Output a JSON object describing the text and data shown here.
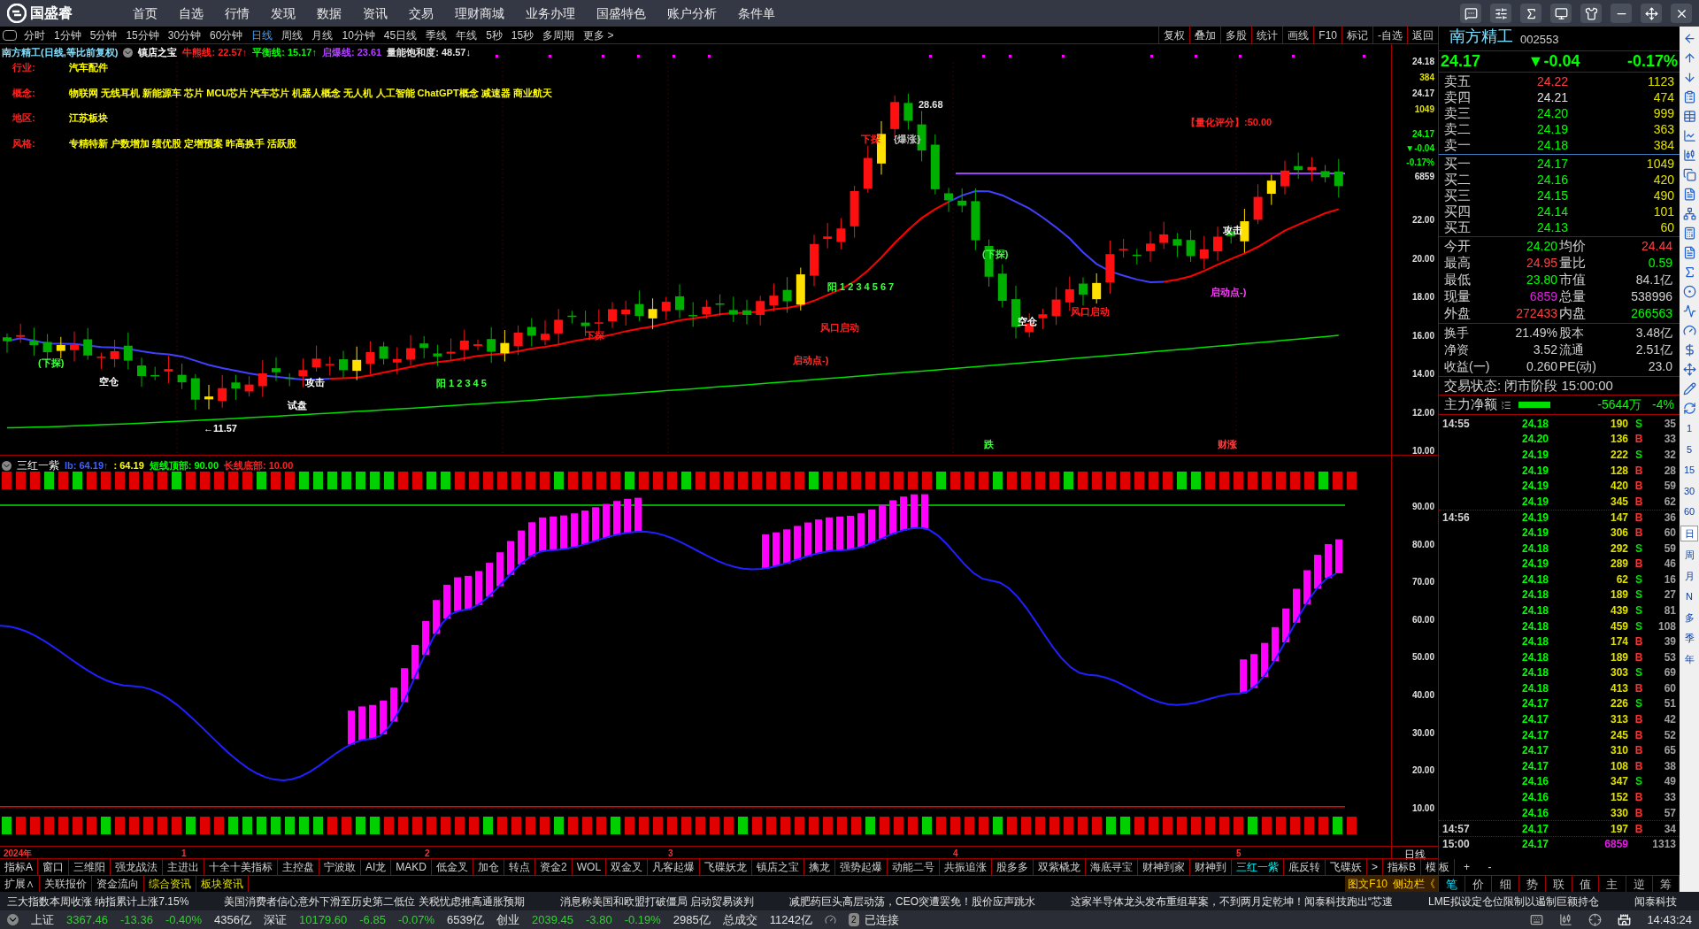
{
  "app": {
    "logo_text": "国盛睿",
    "menu": [
      "首页",
      "自选",
      "行情",
      "发现",
      "数据",
      "资讯",
      "交易",
      "理财商城",
      "业务办理",
      "国盛特色",
      "账户分析",
      "条件单"
    ]
  },
  "periods": [
    {
      "label": "分时",
      "selected": false
    },
    {
      "label": "1分钟",
      "selected": false
    },
    {
      "label": "5分钟",
      "selected": false
    },
    {
      "label": "15分钟",
      "selected": false
    },
    {
      "label": "30分钟",
      "selected": false
    },
    {
      "label": "60分钟",
      "selected": false
    },
    {
      "label": "日线",
      "selected": true
    },
    {
      "label": "周线",
      "selected": false
    },
    {
      "label": "月线",
      "selected": false
    },
    {
      "label": "10分钟",
      "selected": false
    },
    {
      "label": "45日线",
      "selected": false
    },
    {
      "label": "季线",
      "selected": false
    },
    {
      "label": "年线",
      "selected": false
    },
    {
      "label": "5秒",
      "selected": false
    },
    {
      "label": "15秒",
      "selected": false
    },
    {
      "label": "多周期",
      "selected": false
    },
    {
      "label": "更多 >",
      "selected": false
    }
  ],
  "chart_tools": [
    "复权",
    "叠加",
    "多股",
    "统计",
    "画线",
    "F10",
    "标记",
    "-自选",
    "返回"
  ],
  "chart_header": {
    "title": "南方精工(日线,等比前复权)",
    "indicator": "镇店之宝",
    "lines": [
      {
        "label": "牛熊线:",
        "value": "22.57↑",
        "color": "#ff2020"
      },
      {
        "label": "平衡线:",
        "value": "15.17↑",
        "color": "#00ff00"
      },
      {
        "label": "启爆线:",
        "value": "23.61",
        "color": "#b040ff"
      },
      {
        "label": "量能饱和度:",
        "value": "48.57↓",
        "color": "#e0e0e0"
      }
    ]
  },
  "stock_info": [
    {
      "label": "行业:",
      "value": "汽车配件"
    },
    {
      "label": "概念:",
      "value": "物联网 无线耳机 新能源车 芯片 MCU芯片 汽车芯片 机器人概念 无人机 人工智能 ChatGPT概念 减速器 商业航天"
    },
    {
      "label": "地区:",
      "value": "江苏板块"
    },
    {
      "label": "风格:",
      "value": "专精特新 户数增加 绩优股 定增预案 昨高换手 活跃股"
    }
  ],
  "chart_labels": [
    {
      "text": "28.68",
      "color": "#e0e0e0"
    },
    {
      "text": "【量化评分】:50.00",
      "color": "#ff2020"
    },
    {
      "text": "下探",
      "color": "#ff2020"
    },
    {
      "text": "{爆涨}",
      "color": "#c0c0c0"
    },
    {
      "text": "攻击",
      "color": "#ffffff"
    },
    {
      "text": "(下探)",
      "color": "#40ff40"
    },
    {
      "text": "阳 1 2 3 4 5 6 7",
      "color": "#40ff40"
    },
    {
      "text": "启动点-)",
      "color": "#ff40ff"
    },
    {
      "text": "风口启动",
      "color": "#ff2020"
    },
    {
      "text": "空仓",
      "color": "#ffffff"
    },
    {
      "text": "风口启动",
      "color": "#ff2020"
    },
    {
      "text": "下探",
      "color": "#ff2020"
    },
    {
      "text": "启动点-)",
      "color": "#ff3030"
    },
    {
      "text": "(下探)",
      "color": "#40ff40"
    },
    {
      "text": "空仓",
      "color": "#ffffff"
    },
    {
      "text": "攻击",
      "color": "#ffffff"
    },
    {
      "text": "阳 1 2 3 4 5",
      "color": "#40ff40"
    },
    {
      "text": "试盘",
      "color": "#ffffff"
    },
    {
      "text": "←11.57",
      "color": "#ffffff"
    },
    {
      "text": "跌",
      "color": "#40ff40"
    },
    {
      "text": "财涨",
      "color": "#ff4040"
    }
  ],
  "price_axis": {
    "quote": [
      {
        "text": "24.18",
        "color": "#e0e0e0"
      },
      {
        "text": "384",
        "color": "#e0e000"
      },
      {
        "text": "24.17",
        "color": "#e0e0e0"
      },
      {
        "text": "1049",
        "color": "#e0e000"
      },
      {
        "text": "24.17",
        "color": "#00ff00"
      },
      {
        "text": "▼-0.04",
        "color": "#00ff00"
      },
      {
        "text": "-0.17%",
        "color": "#00ff00"
      },
      {
        "text": "6859",
        "color": "#e0e0e0"
      }
    ],
    "ticks": [
      "22.00",
      "20.00",
      "18.00",
      "16.00",
      "14.00",
      "12.00",
      "10.00"
    ]
  },
  "indicator_header": {
    "name": "三红一紫",
    "parts": [
      {
        "text": "lb: 64.19↑",
        "color": "#4060ff"
      },
      {
        "text": ": 64.19",
        "color": "#ffff00"
      },
      {
        "text": "短线顶部: 90.00",
        "color": "#00ff00"
      },
      {
        "text": "长线底部: 10.00",
        "color": "#ff2020"
      }
    ]
  },
  "indicator_axis": [
    "90.00",
    "80.00",
    "70.00",
    "60.00",
    "50.00",
    "40.00",
    "30.00",
    "20.00",
    "10.00"
  ],
  "date_axis": [
    "2024年",
    "1",
    "2",
    "3",
    "4",
    "5"
  ],
  "period_label": "日线",
  "indicator_tabs": [
    {
      "label": "指标A",
      "selected": false
    },
    {
      "label": "窗口",
      "selected": false
    },
    {
      "label": "三维阳",
      "selected": false
    },
    {
      "label": "强龙战法",
      "selected": false
    },
    {
      "label": "主进出",
      "selected": false
    },
    {
      "label": "十全十美指标",
      "selected": false
    },
    {
      "label": "主控盘",
      "selected": false
    },
    {
      "label": "宁波敢",
      "selected": false
    },
    {
      "label": "AI龙",
      "selected": false
    },
    {
      "label": "MAKD",
      "selected": false
    },
    {
      "label": "低金叉",
      "selected": false
    },
    {
      "label": "加仓",
      "selected": false
    },
    {
      "label": "转点",
      "selected": false
    },
    {
      "label": "资金2",
      "selected": false
    },
    {
      "label": "WOL",
      "selected": false
    },
    {
      "label": "双金叉",
      "selected": false
    },
    {
      "label": "凡客起爆",
      "selected": false
    },
    {
      "label": "飞碟妖龙",
      "selected": false
    },
    {
      "label": "镇店之宝",
      "selected": false
    },
    {
      "label": "擒龙",
      "selected": false
    },
    {
      "label": "强势起爆",
      "selected": false
    },
    {
      "label": "动能二号",
      "selected": false
    },
    {
      "label": "共振追涨",
      "selected": false
    },
    {
      "label": "股多多",
      "selected": false
    },
    {
      "label": "双紫橇龙",
      "selected": false
    },
    {
      "label": "海底寻宝",
      "selected": false
    },
    {
      "label": "财神到家",
      "selected": false
    },
    {
      "label": "财神到",
      "selected": false
    },
    {
      "label": "三红一紫",
      "selected": true
    },
    {
      "label": "底反转",
      "selected": false
    },
    {
      "label": "飞碟妖",
      "selected": false
    },
    {
      "label": ">",
      "selected": false
    }
  ],
  "indicator_tabs_right": [
    "指标B",
    "模 板"
  ],
  "zoom_buttons": [
    "+",
    "-"
  ],
  "extra_tabs": [
    {
      "label": "扩展∧",
      "highlight": false
    },
    {
      "label": "关联报价",
      "highlight": false
    },
    {
      "label": "资金流向",
      "highlight": false
    },
    {
      "label": "综合资讯",
      "highlight": true
    },
    {
      "label": "板块资讯",
      "highlight": true
    }
  ],
  "side_links": [
    "图文F10",
    "侧边栏《"
  ],
  "quote_panel": {
    "name": "南方精工",
    "code": "002553",
    "price": "24.17",
    "change": "▼-0.04",
    "change_pct": "-0.17%",
    "asks": [
      {
        "label": "卖五",
        "price": "24.22",
        "volume": "1123",
        "color": "#ff4040"
      },
      {
        "label": "卖四",
        "price": "24.21",
        "volume": "474",
        "color": "#e0e0e0"
      },
      {
        "label": "卖三",
        "price": "24.20",
        "volume": "999",
        "color": "#00ff00"
      },
      {
        "label": "卖二",
        "price": "24.19",
        "volume": "363",
        "color": "#00ff00"
      },
      {
        "label": "卖一",
        "price": "24.18",
        "volume": "384",
        "color": "#00ff00"
      }
    ],
    "bids": [
      {
        "label": "买一",
        "price": "24.17",
        "volume": "1049",
        "color": "#00ff00"
      },
      {
        "label": "买二",
        "price": "24.16",
        "volume": "420",
        "color": "#00ff00"
      },
      {
        "label": "买三",
        "price": "24.15",
        "volume": "490",
        "color": "#00ff00"
      },
      {
        "label": "买四",
        "price": "24.14",
        "volume": "101",
        "color": "#00ff00"
      },
      {
        "label": "买五",
        "price": "24.13",
        "volume": "60",
        "color": "#00ff00"
      }
    ],
    "stats": [
      {
        "label": "今开",
        "value": "24.20",
        "color": "#00ff00"
      },
      {
        "label": "均价",
        "value": "24.44",
        "color": "#ff4040"
      },
      {
        "label": "最高",
        "value": "24.95",
        "color": "#ff4040"
      },
      {
        "label": "量比",
        "value": "0.59",
        "color": "#00ff00"
      },
      {
        "label": "最低",
        "value": "23.80",
        "color": "#00ff00"
      },
      {
        "label": "市值",
        "value": "84.1亿",
        "color": "#d0d0d0"
      },
      {
        "label": "现量",
        "value": "6859",
        "color": "#e020e0"
      },
      {
        "label": "总量",
        "value": "538996",
        "color": "#d0d0d0"
      },
      {
        "label": "外盘",
        "value": "272433",
        "color": "#ff4040"
      },
      {
        "label": "内盘",
        "value": "266563",
        "color": "#00ff00"
      }
    ],
    "fundamentals": [
      {
        "label": "换手",
        "value": "21.49%"
      },
      {
        "label": "股本",
        "value": "3.48亿"
      },
      {
        "label": "净资",
        "value": "3.52"
      },
      {
        "label": "流通",
        "value": "2.51亿"
      },
      {
        "label": "收益(一)",
        "value": "0.260"
      },
      {
        "label": "PE(动)",
        "value": "23.0"
      }
    ],
    "trade_status": "交易状态: 闭市阶段 15:00:00",
    "main_flow": {
      "label": "主力净额",
      "value": "-5644万",
      "pct": "-4%"
    }
  },
  "trades": [
    {
      "time": "14:55",
      "price": "24.18",
      "volume": "190",
      "side": "S",
      "count": "35"
    },
    {
      "price": "24.20",
      "volume": "136",
      "side": "B",
      "count": "33"
    },
    {
      "price": "24.19",
      "volume": "222",
      "side": "S",
      "count": "32"
    },
    {
      "price": "24.19",
      "volume": "128",
      "side": "B",
      "count": "28"
    },
    {
      "price": "24.19",
      "volume": "420",
      "side": "B",
      "count": "59"
    },
    {
      "price": "24.19",
      "volume": "345",
      "side": "B",
      "count": "62"
    },
    {
      "time": "14:56",
      "price": "24.19",
      "volume": "147",
      "side": "B",
      "count": "36"
    },
    {
      "price": "24.19",
      "volume": "306",
      "side": "B",
      "count": "60"
    },
    {
      "price": "24.18",
      "volume": "292",
      "side": "S",
      "count": "59"
    },
    {
      "price": "24.19",
      "volume": "289",
      "side": "B",
      "count": "46"
    },
    {
      "price": "24.18",
      "volume": "62",
      "side": "S",
      "count": "16"
    },
    {
      "price": "24.18",
      "volume": "189",
      "side": "S",
      "count": "27"
    },
    {
      "price": "24.18",
      "volume": "439",
      "side": "S",
      "count": "81"
    },
    {
      "price": "24.18",
      "volume": "459",
      "side": "S",
      "count": "108"
    },
    {
      "price": "24.18",
      "volume": "174",
      "side": "B",
      "count": "39"
    },
    {
      "price": "24.18",
      "volume": "189",
      "side": "B",
      "count": "53"
    },
    {
      "price": "24.18",
      "volume": "303",
      "side": "S",
      "count": "69"
    },
    {
      "price": "24.18",
      "volume": "413",
      "side": "B",
      "count": "60"
    },
    {
      "price": "24.17",
      "volume": "226",
      "side": "S",
      "count": "51"
    },
    {
      "price": "24.17",
      "volume": "313",
      "side": "B",
      "count": "42"
    },
    {
      "price": "24.17",
      "volume": "245",
      "side": "B",
      "count": "52"
    },
    {
      "price": "24.17",
      "volume": "310",
      "side": "B",
      "count": "65"
    },
    {
      "price": "24.17",
      "volume": "108",
      "side": "B",
      "count": "38"
    },
    {
      "price": "24.16",
      "volume": "347",
      "side": "S",
      "count": "49"
    },
    {
      "price": "24.16",
      "volume": "152",
      "side": "B",
      "count": "33"
    },
    {
      "price": "24.16",
      "volume": "330",
      "side": "B",
      "count": "57"
    },
    {
      "time": "14:57",
      "price": "24.17",
      "volume": "197",
      "side": "B",
      "count": "34"
    },
    {
      "time": "15:00",
      "price": "24.17",
      "volume": "6859",
      "kind": "close",
      "count": "1313"
    }
  ],
  "trade_tabs": [
    {
      "label": "笔",
      "selected": true
    },
    {
      "label": "价",
      "selected": false
    },
    {
      "label": "细",
      "selected": false
    },
    {
      "label": "势",
      "selected": false
    },
    {
      "label": "联",
      "selected": false
    },
    {
      "label": "值",
      "selected": false
    },
    {
      "label": "主",
      "selected": false
    },
    {
      "label": "逆",
      "selected": false
    },
    {
      "label": "筹",
      "selected": false
    }
  ],
  "side_periods": [
    {
      "label": "1",
      "selected": false
    },
    {
      "label": "5",
      "selected": false
    },
    {
      "label": "15",
      "selected": false
    },
    {
      "label": "30",
      "selected": false
    },
    {
      "label": "60",
      "selected": false
    },
    {
      "label": "日",
      "selected": true
    },
    {
      "label": "周",
      "selected": false
    },
    {
      "label": "月",
      "selected": false
    },
    {
      "label": "N",
      "selected": false
    },
    {
      "label": "多",
      "selected": false
    },
    {
      "label": "季",
      "selected": false
    },
    {
      "label": "年",
      "selected": false
    }
  ],
  "news": [
    "三大指数本周收涨  纳指累计上涨7.15%",
    "美国消费者信心意外下滑至历史第二低位 关税忧虑推高通胀预期",
    "消息称美国和欧盟打破僵局  启动贸易谈判",
    "减肥药巨头高层动荡，CEO突遭罢免！股价应声跳水",
    "这家半导体龙头发布重组草案，不到两月定乾坤！闻泰科技跑出“芯速",
    "LME拟设定仓位限制以遏制巨额持仓",
    "闻泰科技"
  ],
  "indices": [
    {
      "name": "上证",
      "value": "3367.46",
      "change": "-13.36",
      "pct": "-0.40%",
      "amount": "4356亿"
    },
    {
      "name": "深证",
      "value": "10179.60",
      "change": "-6.85",
      "pct": "-0.07%",
      "amount": "6539亿"
    },
    {
      "name": "创业",
      "value": "2039.45",
      "change": "-3.80",
      "pct": "-0.19%",
      "amount": "2985亿"
    }
  ],
  "total_turnover": {
    "label": "总成交",
    "value": "11242亿"
  },
  "connection": {
    "count": "2",
    "status": "已连接"
  },
  "clock": "14:43:24"
}
